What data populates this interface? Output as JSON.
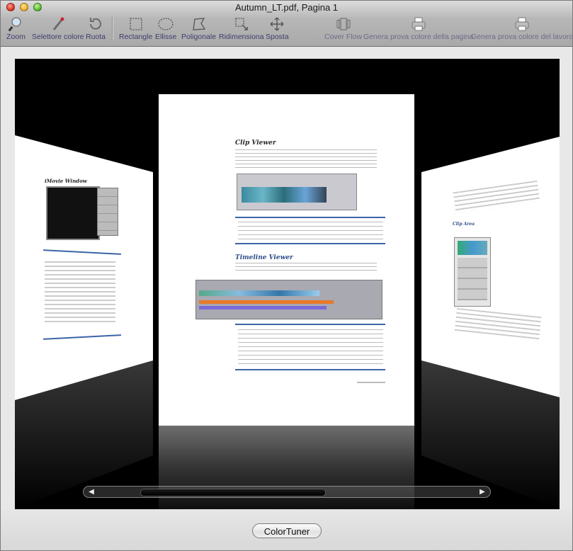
{
  "window": {
    "title": "Autumn_LT.pdf, Pagina 1"
  },
  "toolbar": {
    "items": [
      {
        "label": "Zoom",
        "icon": "magnifier-icon"
      },
      {
        "label": "Selettore colore",
        "icon": "eyedropper-icon"
      },
      {
        "label": "Ruota",
        "icon": "rotate-icon"
      },
      {
        "label": "Rectangle",
        "icon": "rectangle-icon"
      },
      {
        "label": "Ellisse",
        "icon": "ellipse-icon"
      },
      {
        "label": "Poligonale",
        "icon": "polygon-icon"
      },
      {
        "label": "Ridimensiona",
        "icon": "resize-icon"
      },
      {
        "label": "Sposta",
        "icon": "move-icon"
      },
      {
        "label": "Cover Flow",
        "icon": "coverflow-icon"
      },
      {
        "label": "Genera prova colore della pagina",
        "icon": "printer-icon"
      },
      {
        "label": "Genera prova colore del lavoro",
        "icon": "printer-icon"
      }
    ]
  },
  "pages": {
    "left_heading": "iMovie Window",
    "center_heading_1": "Clip Viewer",
    "center_heading_2": "Timeline Viewer",
    "right_heading": "Clip Area"
  },
  "footer": {
    "button_label": "ColorTuner"
  },
  "colors": {
    "accent_blue": "#3c64a7",
    "window_bg": "#e8e8e8"
  }
}
